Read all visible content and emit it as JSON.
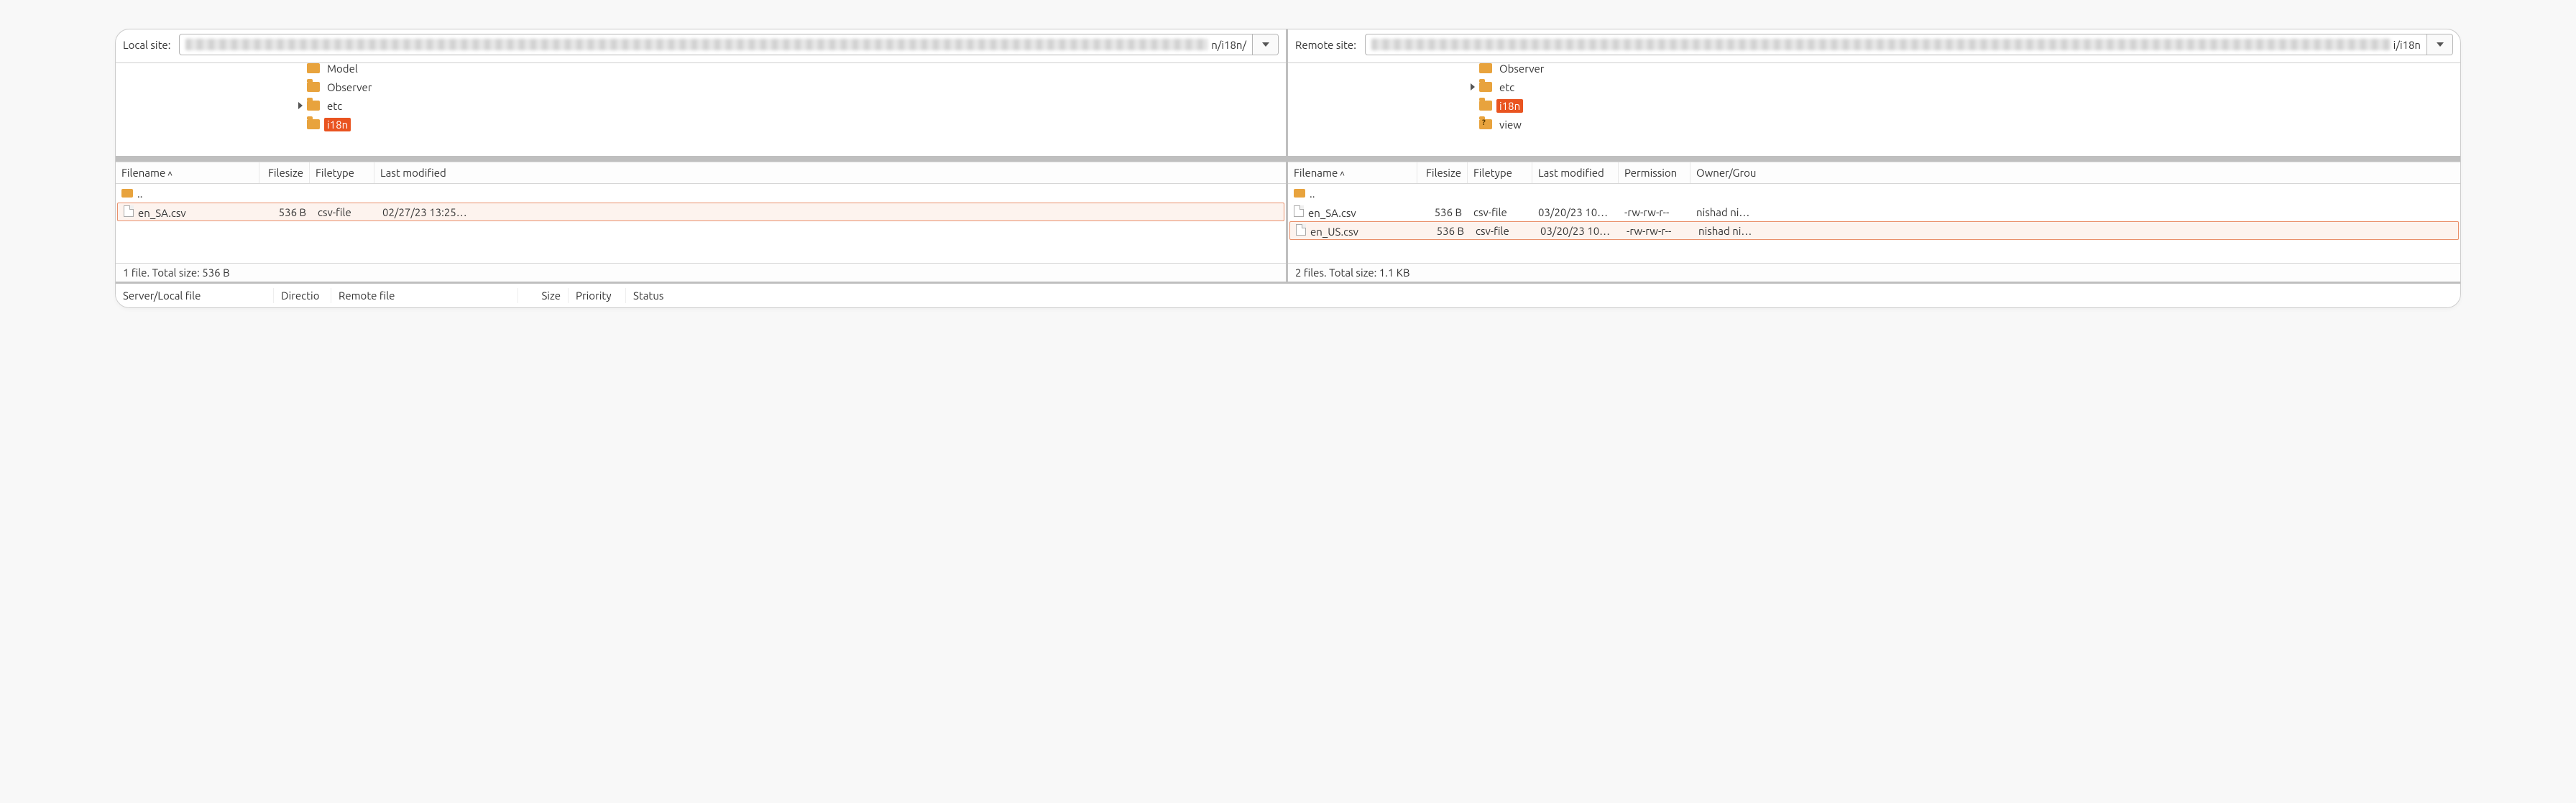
{
  "local": {
    "site_label": "Local site:",
    "path_tail": "n/i18n/",
    "tree": [
      {
        "indent": 11,
        "expander": "",
        "icon": "folder",
        "label": "Model",
        "selected": false,
        "clipped_top": true
      },
      {
        "indent": 11,
        "expander": "",
        "icon": "folder",
        "label": "Observer",
        "selected": false
      },
      {
        "indent": 11,
        "expander": ">",
        "icon": "folder",
        "label": "etc",
        "selected": false
      },
      {
        "indent": 11,
        "expander": "",
        "icon": "folder",
        "label": "i18n",
        "selected": true
      }
    ],
    "headers": [
      "Filename",
      "Filesize",
      "Filetype",
      "Last modified"
    ],
    "files": [
      {
        "icon": "folder",
        "name": "..",
        "size": "",
        "type": "",
        "mod": "",
        "highlight": false
      },
      {
        "icon": "file",
        "name": "en_SA.csv",
        "size": "536 B",
        "type": "csv-file",
        "mod": "02/27/23 13:25…",
        "highlight": true
      }
    ],
    "status": "1 file. Total size: 536 B"
  },
  "remote": {
    "site_label": "Remote site:",
    "path_tail": "i/i18n",
    "tree": [
      {
        "indent": 11,
        "expander": "",
        "icon": "folder",
        "label": "Observer",
        "selected": false,
        "clipped_top": true
      },
      {
        "indent": 11,
        "expander": ">",
        "icon": "folder",
        "label": "etc",
        "selected": false
      },
      {
        "indent": 11,
        "expander": "",
        "icon": "folder",
        "label": "i18n",
        "selected": true
      },
      {
        "indent": 11,
        "expander": "",
        "icon": "folder-q",
        "label": "view",
        "selected": false
      }
    ],
    "headers": [
      "Filename",
      "Filesize",
      "Filetype",
      "Last modified",
      "Permission",
      "Owner/Grou"
    ],
    "files": [
      {
        "icon": "folder",
        "name": "..",
        "size": "",
        "type": "",
        "mod": "",
        "perm": "",
        "own": "",
        "highlight": false
      },
      {
        "icon": "file",
        "name": "en_SA.csv",
        "size": "536 B",
        "type": "csv-file",
        "mod": "03/20/23 10…",
        "perm": "-rw-rw-r--",
        "own": "nishad ni…",
        "highlight": false
      },
      {
        "icon": "file",
        "name": "en_US.csv",
        "size": "536 B",
        "type": "csv-file",
        "mod": "03/20/23 10…",
        "perm": "-rw-rw-r--",
        "own": "nishad ni…",
        "highlight": true
      }
    ],
    "status": "2 files. Total size: 1.1 KB"
  },
  "queue": {
    "headers": [
      "Server/Local file",
      "Directio",
      "Remote file",
      "Size",
      "Priority",
      "Status"
    ]
  }
}
